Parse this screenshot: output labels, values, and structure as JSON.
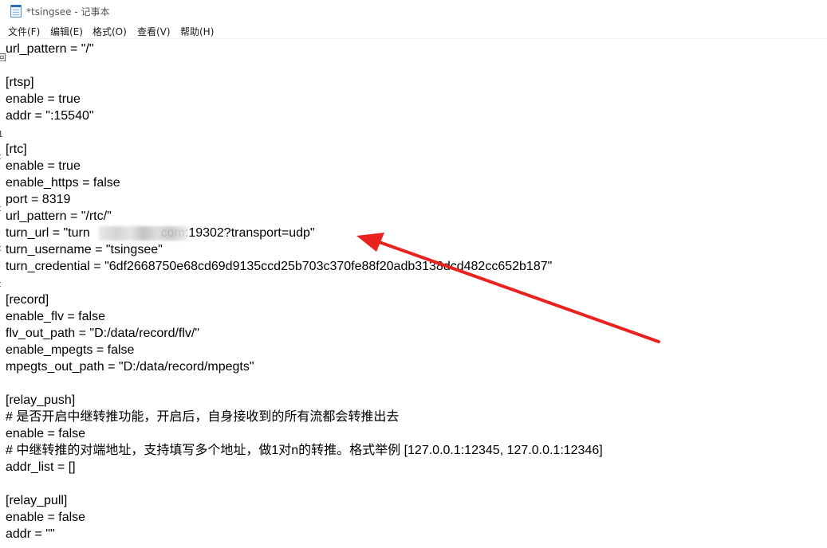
{
  "window": {
    "title": "*tsingsee - 记事本"
  },
  "menu": [
    {
      "label": "文件(F)"
    },
    {
      "label": "编辑(E)"
    },
    {
      "label": "格式(O)"
    },
    {
      "label": "查看(V)"
    },
    {
      "label": "帮助(H)"
    }
  ],
  "editor": {
    "lines": [
      "url_pattern = \"/\"",
      "",
      "[rtsp]",
      "enable = true",
      "addr = \":15540\"",
      "",
      "[rtc]",
      "enable = true",
      "enable_https = false",
      "port = 8319",
      "url_pattern = \"/rtc/\"",
      "turn_url = \"turn                    com:19302?transport=udp\"",
      "turn_username = \"tsingsee\"",
      "turn_credential = \"6df2668750e68cd69d9135ccd25b703c370fe88f20adb3138dcd482cc652b187\"",
      "",
      "[record]",
      "enable_flv = false",
      "flv_out_path = \"D:/data/record/flv/\"",
      "enable_mpegts = false",
      "mpegts_out_path = \"D:/data/record/mpegts\"",
      "",
      "[relay_push]",
      "# 是否开启中继转推功能，开启后，自身接收到的所有流都会转推出去",
      "enable = false",
      "# 中继转推的对端地址，支持填写多个地址，做1对n的转推。格式举例 [127.0.0.1:12345, 127.0.0.1:12346]",
      "addr_list = []",
      "",
      "[relay_pull]",
      "enable = false",
      "addr = \"\""
    ]
  },
  "annotation": {
    "arrow_color": "#e8231f"
  },
  "left_edge_glyphs": [
    "回",
    "i",
    "1",
    "t",
    "t",
    "t",
    "t",
    "I"
  ]
}
